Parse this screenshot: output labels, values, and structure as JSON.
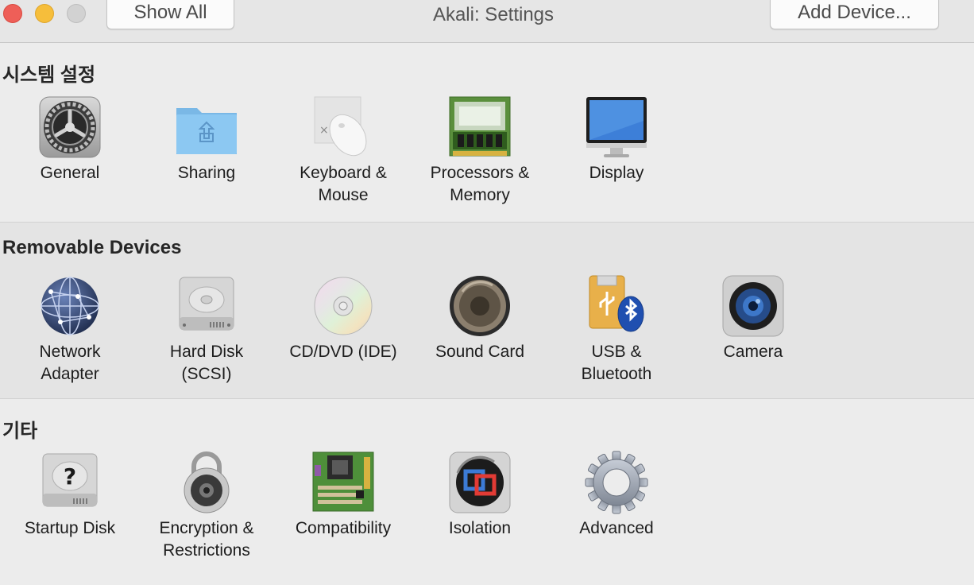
{
  "window": {
    "title": "Akali: Settings",
    "show_all_label": "Show All",
    "add_device_label": "Add Device..."
  },
  "sections": [
    {
      "title": "시스템 설정",
      "items": [
        {
          "label": "General",
          "icon": "general-icon"
        },
        {
          "label": "Sharing",
          "icon": "sharing-folder-icon"
        },
        {
          "label": "Keyboard &\nMouse",
          "icon": "keyboard-mouse-icon"
        },
        {
          "label": "Processors &\nMemory",
          "icon": "memory-chip-icon"
        },
        {
          "label": "Display",
          "icon": "display-icon"
        }
      ]
    },
    {
      "title": "Removable Devices",
      "items": [
        {
          "label": "Network\nAdapter",
          "icon": "network-globe-icon"
        },
        {
          "label": "Hard Disk\n(SCSI)",
          "icon": "hard-disk-icon"
        },
        {
          "label": "CD/DVD (IDE)",
          "icon": "cd-dvd-icon"
        },
        {
          "label": "Sound Card",
          "icon": "speaker-icon"
        },
        {
          "label": "USB &\nBluetooth",
          "icon": "usb-bluetooth-icon"
        },
        {
          "label": "Camera",
          "icon": "camera-icon"
        }
      ]
    },
    {
      "title": "기타",
      "items": [
        {
          "label": "Startup Disk",
          "icon": "startup-disk-icon"
        },
        {
          "label": "Encryption &\nRestrictions",
          "icon": "padlock-icon"
        },
        {
          "label": "Compatibility",
          "icon": "motherboard-icon"
        },
        {
          "label": "Isolation",
          "icon": "isolation-icon"
        },
        {
          "label": "Advanced",
          "icon": "gear-icon"
        }
      ]
    }
  ]
}
